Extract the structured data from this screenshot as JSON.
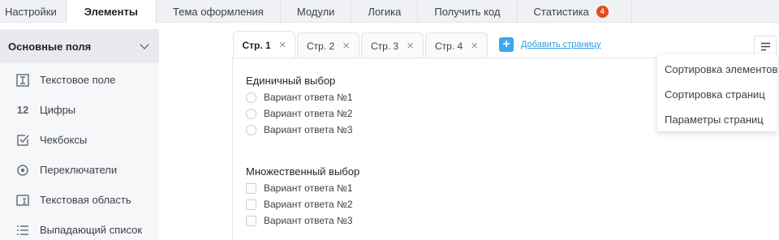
{
  "colors": {
    "accent": "#3aa8ee",
    "badge": "#e64a19",
    "link": "#2f9be3"
  },
  "top_tabs": [
    {
      "label": "Настройки"
    },
    {
      "label": "Элементы",
      "active": true
    },
    {
      "label": "Тема оформления"
    },
    {
      "label": "Модули"
    },
    {
      "label": "Логика"
    },
    {
      "label": "Получить код"
    },
    {
      "label": "Статистика",
      "badge": "4"
    }
  ],
  "sidebar": {
    "header": "Основные поля",
    "items": [
      {
        "label": "Текстовое поле",
        "icon": "text-field-icon"
      },
      {
        "label": "Цифры",
        "icon": "numbers-icon",
        "glyph": "12"
      },
      {
        "label": "Чекбоксы",
        "icon": "checkbox-icon"
      },
      {
        "label": "Переключатели",
        "icon": "radio-icon"
      },
      {
        "label": "Текстовая область",
        "icon": "textarea-icon"
      },
      {
        "label": "Выпадающий список",
        "icon": "list-icon"
      }
    ]
  },
  "page_tabs": [
    {
      "label": "Стр. 1",
      "active": true
    },
    {
      "label": "Стр. 2"
    },
    {
      "label": "Стр. 3"
    },
    {
      "label": "Стр. 4"
    }
  ],
  "add_page_label": "Добавить страницу",
  "menu": {
    "items": [
      "Сортировка элементов",
      "Сортировка страниц",
      "Параметры страниц"
    ]
  },
  "form": {
    "single": {
      "title": "Единичный выбор",
      "options": [
        "Вариант ответа №1",
        "Вариант ответа №2",
        "Вариант ответа №3"
      ]
    },
    "multiple": {
      "title": "Множественный выбор",
      "options": [
        "Вариант ответа №1",
        "Вариант ответа №2",
        "Вариант ответа №3"
      ]
    }
  }
}
